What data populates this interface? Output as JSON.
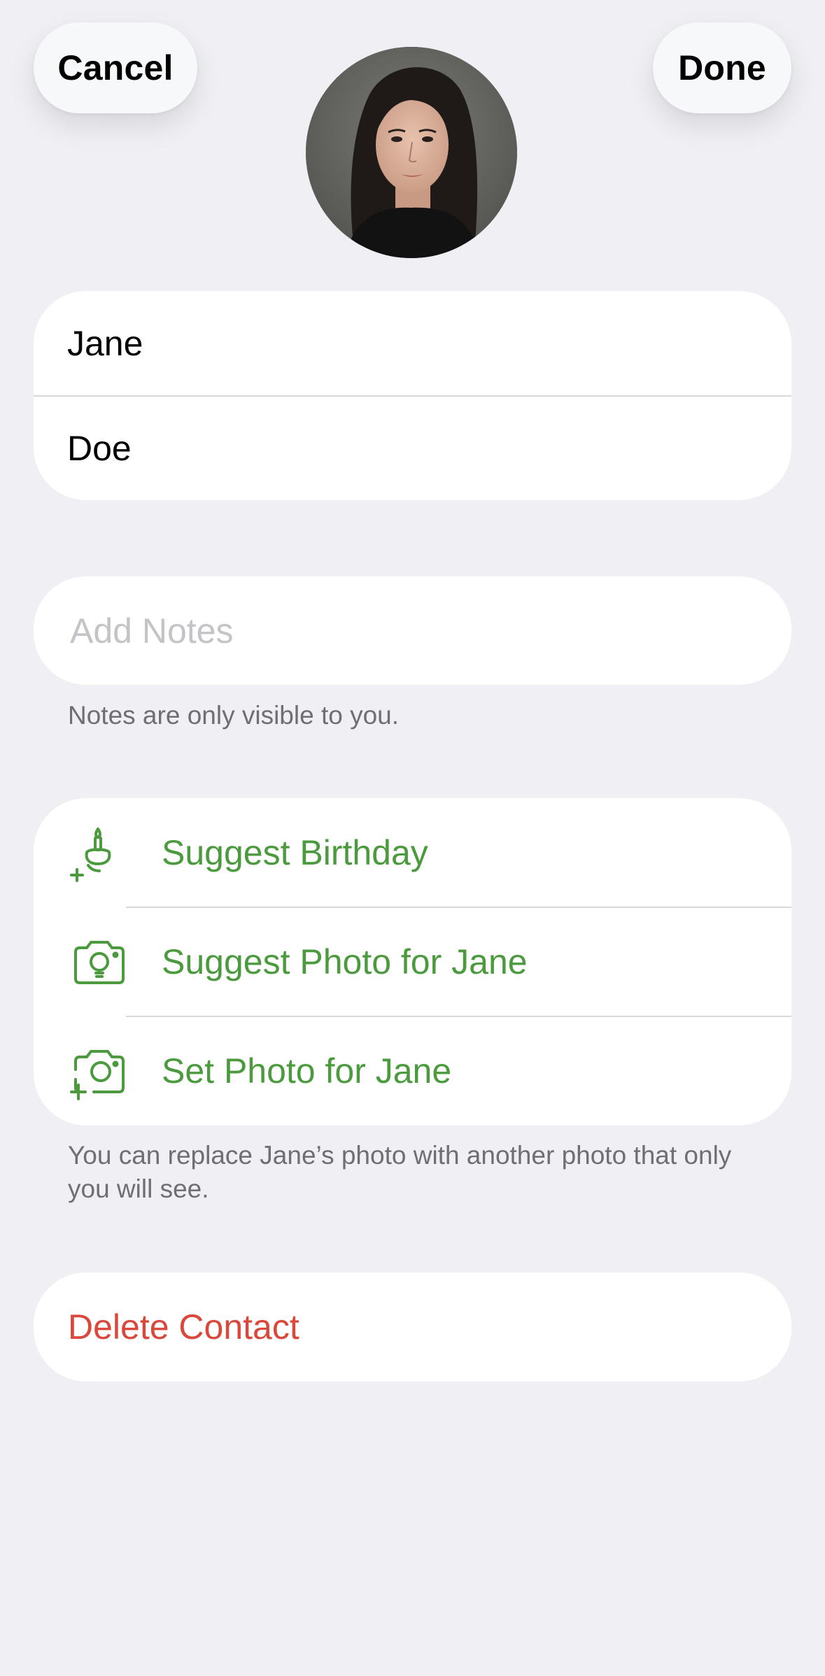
{
  "header": {
    "cancel_label": "Cancel",
    "done_label": "Done"
  },
  "contact": {
    "first_name": "Jane",
    "last_name": "Doe"
  },
  "notes": {
    "placeholder": "Add Notes",
    "caption": "Notes are only visible to you."
  },
  "actions": {
    "items": [
      {
        "label": "Suggest Birthday",
        "icon": "birthday-cake-plus-icon"
      },
      {
        "label": "Suggest Photo for Jane",
        "icon": "camera-lightbulb-icon"
      },
      {
        "label": "Set Photo for Jane",
        "icon": "camera-plus-icon"
      }
    ],
    "caption": "You can replace Jane’s photo with another photo that only you will see."
  },
  "delete": {
    "label": "Delete Contact"
  },
  "colors": {
    "background": "#efeff4",
    "accent_green": "#4b9a3e",
    "destructive_red": "#d9483b",
    "secondary_text": "#6e6e73",
    "placeholder_text": "#c4c4c8"
  }
}
